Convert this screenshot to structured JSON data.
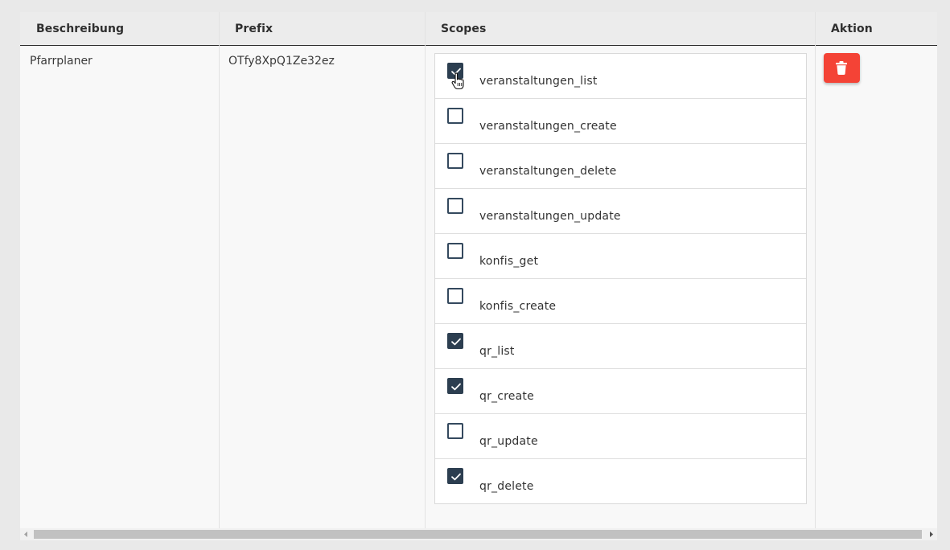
{
  "table": {
    "headers": {
      "description": "Beschreibung",
      "prefix": "Prefix",
      "scopes": "Scopes",
      "action": "Aktion"
    },
    "row": {
      "description": "Pfarrplaner",
      "prefix": "OTfy8XpQ1Ze32ez",
      "scopes": [
        {
          "label": "veranstaltungen_list",
          "checked": true
        },
        {
          "label": "veranstaltungen_create",
          "checked": false
        },
        {
          "label": "veranstaltungen_delete",
          "checked": false
        },
        {
          "label": "veranstaltungen_update",
          "checked": false
        },
        {
          "label": "konfis_get",
          "checked": false
        },
        {
          "label": "konfis_create",
          "checked": false
        },
        {
          "label": "qr_list",
          "checked": true
        },
        {
          "label": "qr_create",
          "checked": true
        },
        {
          "label": "qr_update",
          "checked": false
        },
        {
          "label": "qr_delete",
          "checked": true
        }
      ]
    },
    "delete_icon": "trash-icon"
  },
  "colors": {
    "checkbox_checked": "#2c3e50",
    "delete_button": "#f44336",
    "header_bg": "#ececec"
  }
}
